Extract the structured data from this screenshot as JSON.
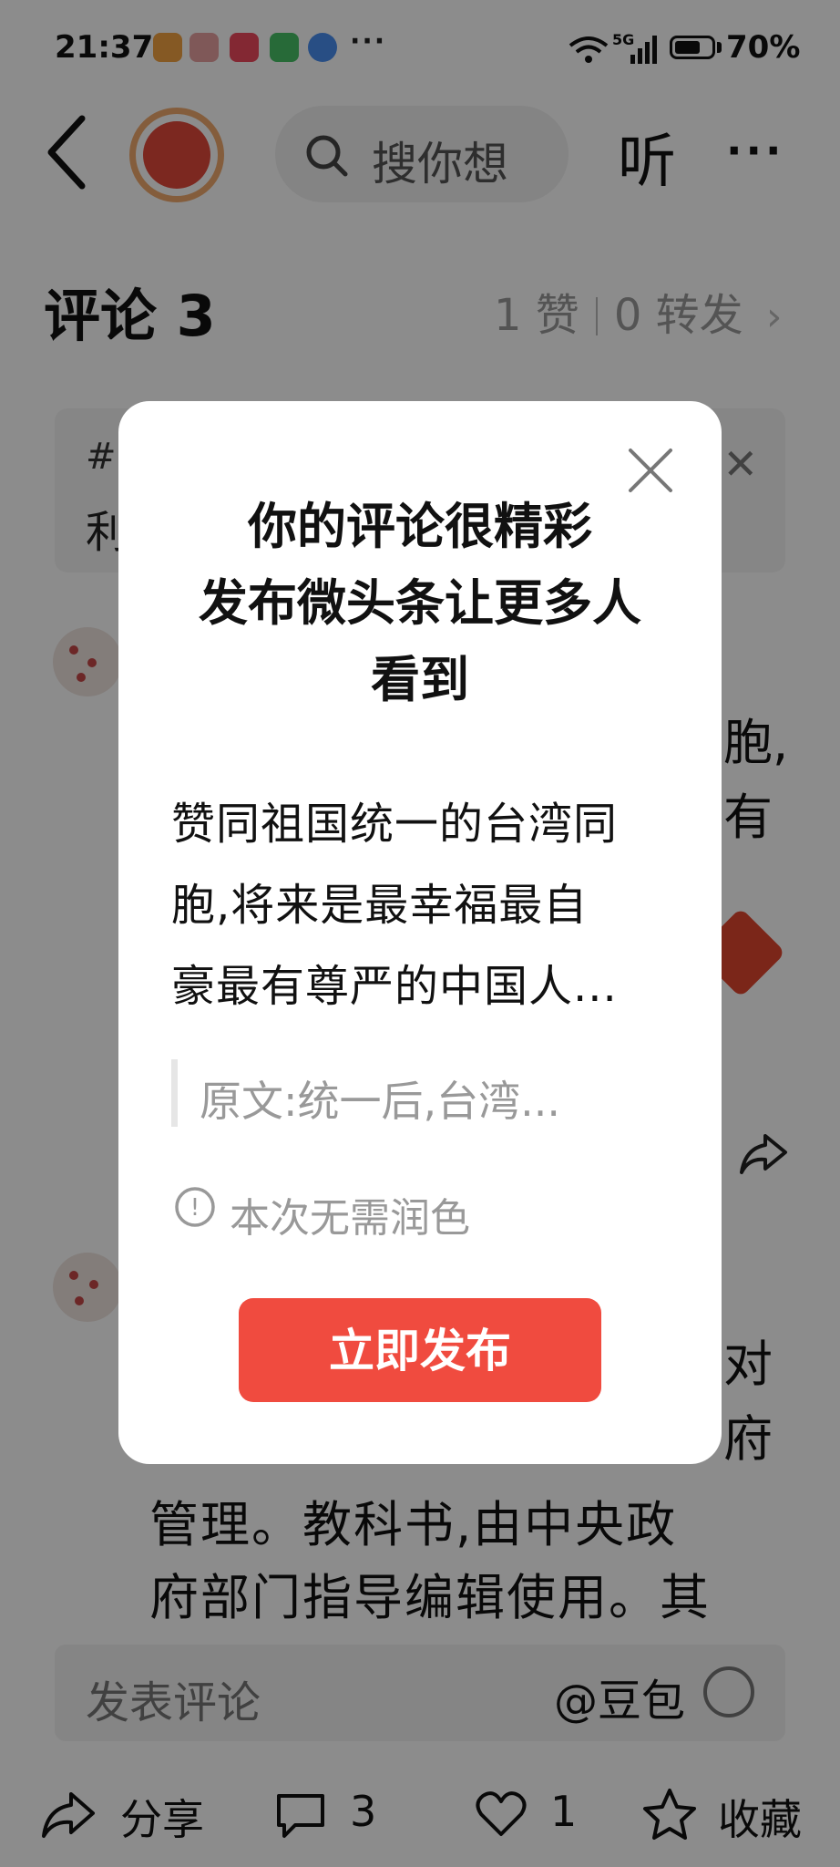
{
  "status_bar": {
    "time": "21:37",
    "network": "5G",
    "battery": "70%",
    "battery_level": 0.7,
    "more_indicator": "···"
  },
  "header": {
    "search_placeholder": "搜你想",
    "listen_label": "听",
    "more_label": "···"
  },
  "comments": {
    "title": "评论 3",
    "likes": "1 赞",
    "reposts": "0 转发",
    "arrow": "›"
  },
  "background": {
    "banner_hash": "#",
    "banner_text": "利",
    "comment1_tail_line1": "胞,",
    "comment1_tail_line2": "有",
    "comment2_tail_line1": "对",
    "comment2_tail_line2": "府",
    "body_line1": "管理。教科书,由中央政",
    "body_line2": "府部门指导编辑使用。其"
  },
  "dialog": {
    "title_line1": "你的评论很精彩",
    "title_line2": "发布微头条让更多人",
    "title_line3": "看到",
    "body_line1": "赞同祖国统一的台湾同",
    "body_line2": "胞,将来是最幸福最自",
    "body_line3": "豪最有尊严的中国人...",
    "quote": "原文:统一后,台湾...",
    "info_icon": "!",
    "info": "本次无需润色",
    "publish_button": "立即发布"
  },
  "comment_input": {
    "placeholder": "发表评论",
    "mention": "@豆包"
  },
  "bottom_bar": {
    "share": "分享",
    "comment_count": "3",
    "like_count": "1",
    "favorite": "收藏"
  },
  "colors": {
    "accent": "#f04b3f",
    "mask": "rgba(0,0,0,0.45)"
  }
}
